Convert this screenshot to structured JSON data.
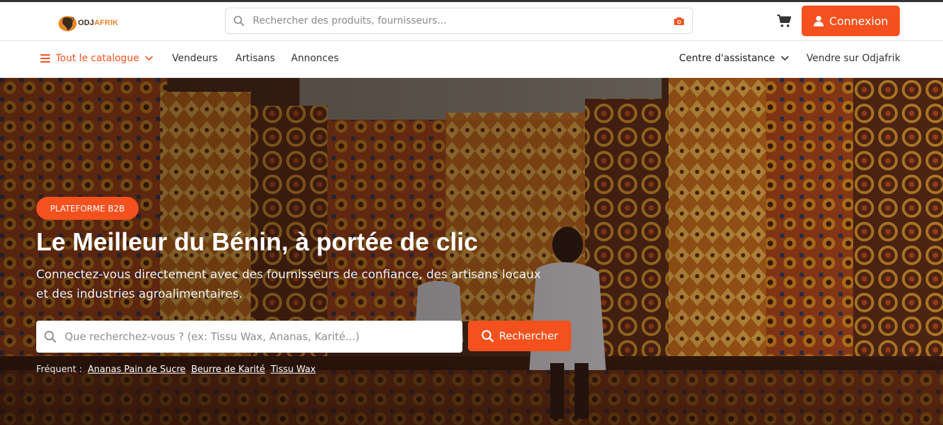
{
  "colors": {
    "accent": "#f4511e",
    "brand_brown": "#3a2a1a",
    "brand_orange": "#e8862a"
  },
  "header": {
    "logo": {
      "text_a": "ODJ",
      "text_b": "AFRIK",
      "icon": "africa-logo-icon"
    },
    "search": {
      "placeholder": "Rechercher des produits, fournisseurs...",
      "icon": "search-icon",
      "camera_icon": "camera-icon"
    },
    "cart_icon": "shopping-cart-icon",
    "login_label": "Connexion",
    "login_icon": "user-icon"
  },
  "nav": {
    "catalogue": "Tout le catalogue",
    "items": [
      "Vendeurs",
      "Artisans",
      "Annonces"
    ],
    "help": "Centre d'assistance",
    "sell": "Vendre sur Odjafrik"
  },
  "hero": {
    "badge": "PLATEFORME B2B",
    "title": "Le Meilleur du Bénin, à portée de clic",
    "subtitle": "Connectez-vous directement avec des fournisseurs de confiance, des artisans locaux et des industries agroalimentaires.",
    "search_placeholder": "Que recherchez-vous ? (ex: Tissu Wax, Ananas, Karité...)",
    "search_button": "Rechercher",
    "frequent_label": "Fréquent :",
    "frequent": [
      "Ananas Pain de Sucre",
      "Beurre de Karité",
      "Tissu Wax"
    ]
  }
}
